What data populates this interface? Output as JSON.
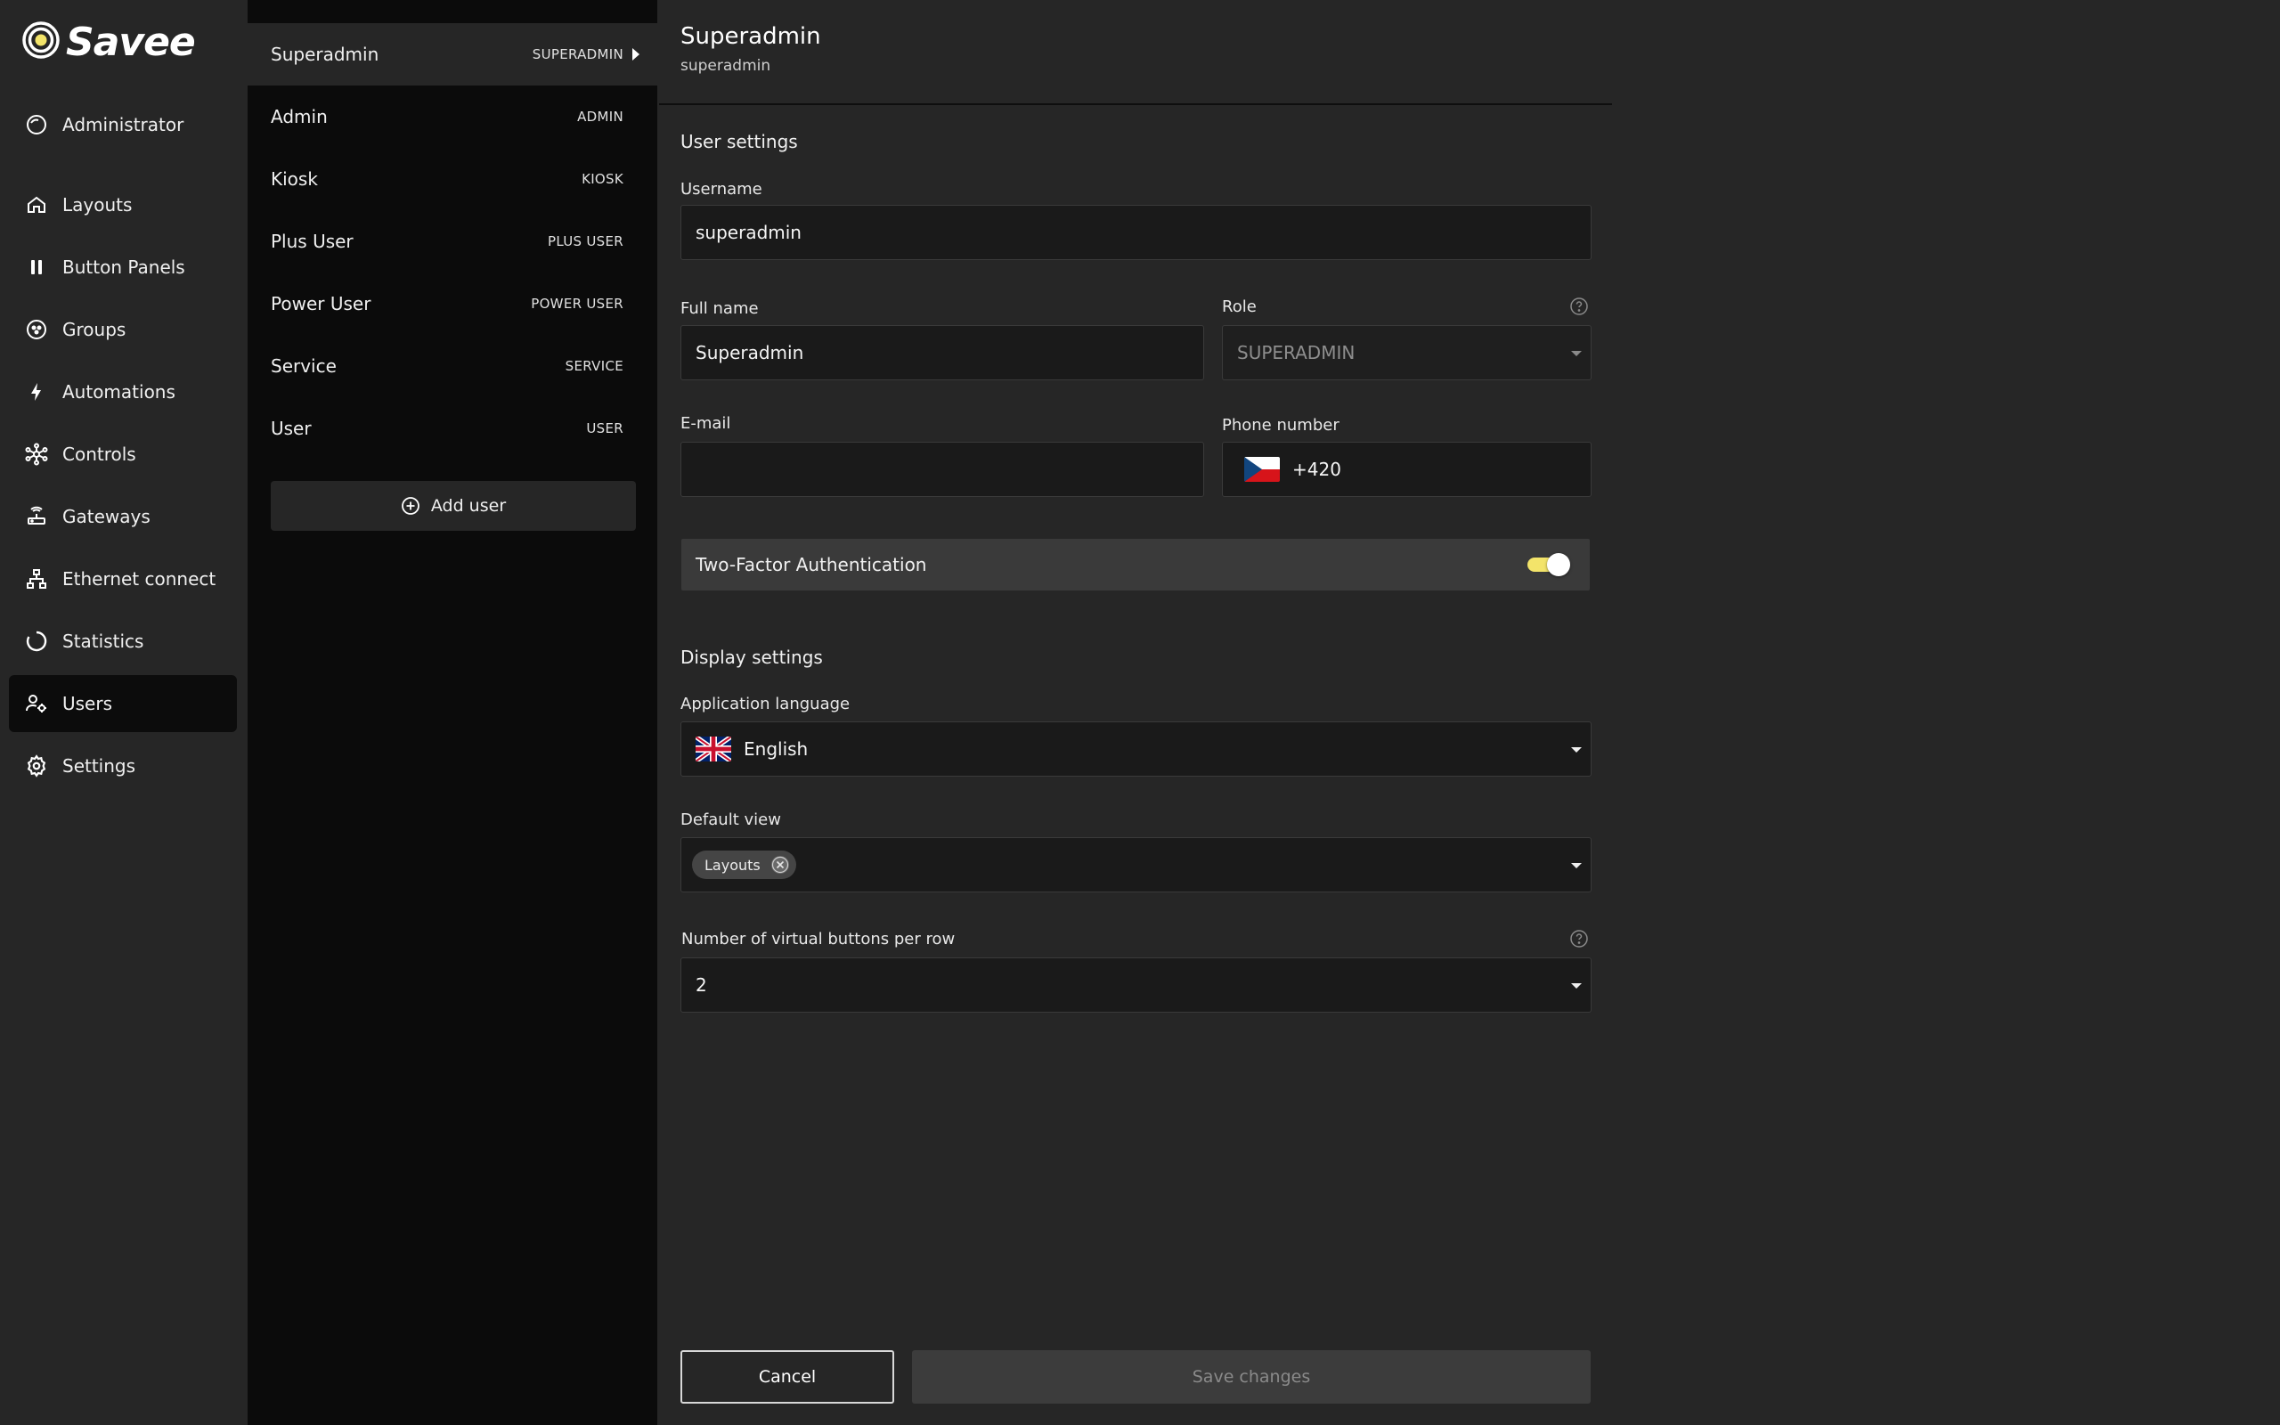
{
  "brand": {
    "name": "Savee",
    "accent": "#f3e46a"
  },
  "sidebar": {
    "items": [
      {
        "label": "Administrator",
        "icon": "administrator-face-icon"
      },
      {
        "label": "Layouts",
        "icon": "home-icon"
      },
      {
        "label": "Button Panels",
        "icon": "pause-bars-icon"
      },
      {
        "label": "Groups",
        "icon": "groups-circle-icon"
      },
      {
        "label": "Automations",
        "icon": "lightning-icon"
      },
      {
        "label": "Controls",
        "icon": "nodes-icon"
      },
      {
        "label": "Gateways",
        "icon": "router-icon"
      },
      {
        "label": "Ethernet connect",
        "icon": "network-icon"
      },
      {
        "label": "Statistics",
        "icon": "circle-chart-icon"
      },
      {
        "label": "Users",
        "icon": "users-gear-icon",
        "active": true
      },
      {
        "label": "Settings",
        "icon": "gear-icon"
      }
    ]
  },
  "users": {
    "list": [
      {
        "name": "Superadmin",
        "role": "SUPERADMIN",
        "selected": true
      },
      {
        "name": "Admin",
        "role": "ADMIN"
      },
      {
        "name": "Kiosk",
        "role": "KIOSK"
      },
      {
        "name": "Plus User",
        "role": "PLUS USER"
      },
      {
        "name": "Power User",
        "role": "POWER USER"
      },
      {
        "name": "Service",
        "role": "SERVICE"
      },
      {
        "name": "User",
        "role": "USER"
      }
    ],
    "add_label": "Add user"
  },
  "detail": {
    "title": "Superadmin",
    "subtitle": "superadmin",
    "user_settings": {
      "heading": "User settings",
      "username_label": "Username",
      "username_value": "superadmin",
      "fullname_label": "Full name",
      "fullname_value": "Superadmin",
      "role_label": "Role",
      "role_value": "SUPERADMIN",
      "email_label": "E-mail",
      "email_value": "",
      "phone_label": "Phone number",
      "phone_value": "+420",
      "twofa_label": "Two-Factor Authentication",
      "twofa_enabled": true
    },
    "display_settings": {
      "heading": "Display settings",
      "language_label": "Application language",
      "language_value": "English",
      "default_view_label": "Default view",
      "default_view_chip": "Layouts",
      "buttons_per_row_label": "Number of virtual buttons per row",
      "buttons_per_row_value": "2"
    },
    "actions": {
      "cancel": "Cancel",
      "save": "Save changes"
    }
  }
}
